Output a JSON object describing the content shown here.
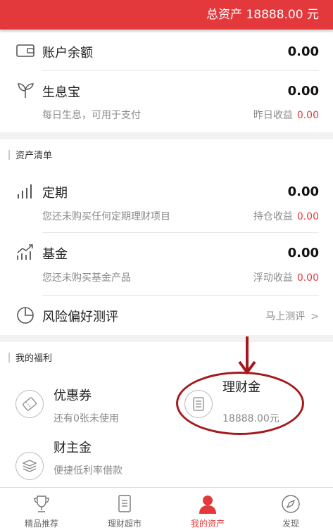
{
  "header": {
    "total_assets": "总资产 18888.00 元"
  },
  "account": {
    "label": "账户余额",
    "amount": "0.00"
  },
  "shengxibao": {
    "label": "生息宝",
    "amount": "0.00",
    "desc": "每日生息，可用于支付",
    "yield_label": "昨日收益",
    "yield_value": "0.00"
  },
  "assets_section": {
    "title": "资产清单"
  },
  "dingqi": {
    "label": "定期",
    "amount": "0.00",
    "desc": "您还未购买任何定期理财项目",
    "yield_label": "持仓收益",
    "yield_value": "0.00"
  },
  "jijin": {
    "label": "基金",
    "amount": "0.00",
    "desc": "您还未购买基金产品",
    "yield_label": "浮动收益",
    "yield_value": "0.00"
  },
  "risk": {
    "label": "风险偏好测评",
    "action": "马上测评",
    "chevron": ">"
  },
  "welfare_section": {
    "title": "我的福利"
  },
  "coupon": {
    "label": "优惠券",
    "desc": "还有0张未使用"
  },
  "licaijin": {
    "label": "理财金",
    "value": "18888.00元"
  },
  "caizhujin": {
    "label": "财主金",
    "desc": "便捷低利率借款"
  },
  "tabs": [
    {
      "label": "精品推荐",
      "icon": "trophy-icon"
    },
    {
      "label": "理财超市",
      "icon": "document-icon"
    },
    {
      "label": "我的资产",
      "icon": "person-icon"
    },
    {
      "label": "发现",
      "icon": "compass-icon"
    }
  ],
  "colors": {
    "brand_red": "#e4393c",
    "annotation_red": "#a5191d"
  }
}
